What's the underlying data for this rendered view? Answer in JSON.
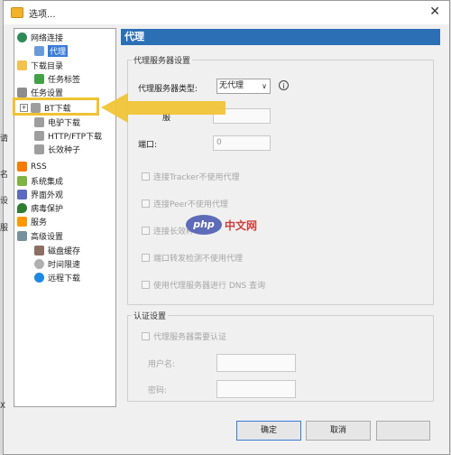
{
  "window": {
    "title": "选项..."
  },
  "tree": {
    "items": [
      {
        "label": "网络连接"
      },
      {
        "label": "代理"
      },
      {
        "label": "下载目录"
      },
      {
        "label": "任务标签"
      },
      {
        "label": "任务设置"
      },
      {
        "label": "BT下载"
      },
      {
        "label": "电驴下载"
      },
      {
        "label": "HTTP/FTP下载"
      },
      {
        "label": "长效种子"
      },
      {
        "label": "RSS"
      },
      {
        "label": "系统集成"
      },
      {
        "label": "界面外观"
      },
      {
        "label": "病毒保护"
      },
      {
        "label": "服务"
      },
      {
        "label": "高级设置"
      },
      {
        "label": "磁盘缓存"
      },
      {
        "label": "时间限速"
      },
      {
        "label": "远程下载"
      }
    ]
  },
  "panel": {
    "header": "代理",
    "proxy_group": {
      "legend": "代理服务器设置",
      "type_label": "代理服务器类型:",
      "type_value": "无代理",
      "server_label": "服",
      "port_label": "端口:",
      "port_value": "0",
      "checkboxes": [
        {
          "label": "连接Tracker不使用代理"
        },
        {
          "label": "连接Peer不使用代理"
        },
        {
          "label": "连接长效种"
        },
        {
          "label": "端口转发检测不使用代理"
        },
        {
          "label": "使用代理服务器进行 DNS 查询"
        }
      ]
    },
    "auth_group": {
      "legend": "认证设置",
      "require_label": "代理服务器需要认证",
      "user_label": "用户名:",
      "pass_label": "密码:"
    }
  },
  "buttons": {
    "ok": "确定",
    "cancel": "取消"
  },
  "watermark": {
    "brand": "php",
    "site": "中文网"
  },
  "edge_chars": [
    "请",
    "名",
    "设",
    "服",
    "X"
  ],
  "colors": {
    "accent": "#2c6fb5",
    "selection": "#3a7bd5",
    "arrow": "#f1c232"
  }
}
